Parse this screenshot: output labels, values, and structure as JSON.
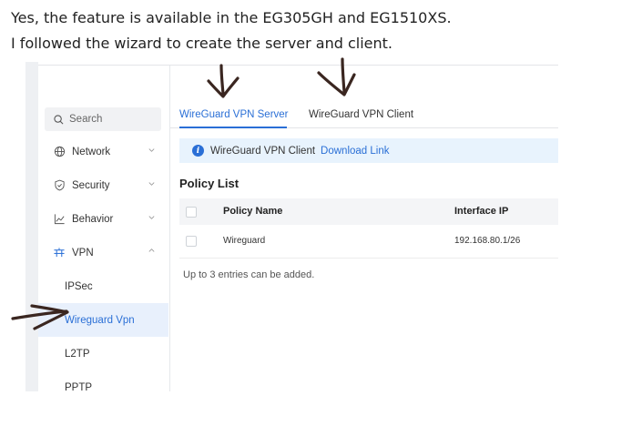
{
  "post": {
    "line1": "Yes, the feature is available in the EG305GH and EG1510XS.",
    "line2": "I followed the wizard to create the server and client."
  },
  "sidebar": {
    "search_placeholder": "Search",
    "items": [
      {
        "label": "Network",
        "icon": "globe-icon"
      },
      {
        "label": "Security",
        "icon": "shield-icon"
      },
      {
        "label": "Behavior",
        "icon": "chart-icon"
      },
      {
        "label": "VPN",
        "icon": "vpn-icon"
      }
    ],
    "vpn_subitems": [
      "IPSec",
      "Wireguard Vpn",
      "L2TP",
      "PPTP"
    ]
  },
  "tabs": {
    "server": "WireGuard VPN Server",
    "client": "WireGuard VPN Client"
  },
  "info_bar": {
    "text": "WireGuard VPN Client",
    "link": "Download Link"
  },
  "policy": {
    "title": "Policy List",
    "columns": {
      "name": "Policy Name",
      "ip": "Interface IP"
    },
    "rows": [
      {
        "name": "Wireguard",
        "ip": "192.168.80.1/26"
      }
    ],
    "footnote": "Up to 3 entries can be added."
  },
  "colors": {
    "accent": "#2a6fd6",
    "annotation": "#3a2620"
  }
}
